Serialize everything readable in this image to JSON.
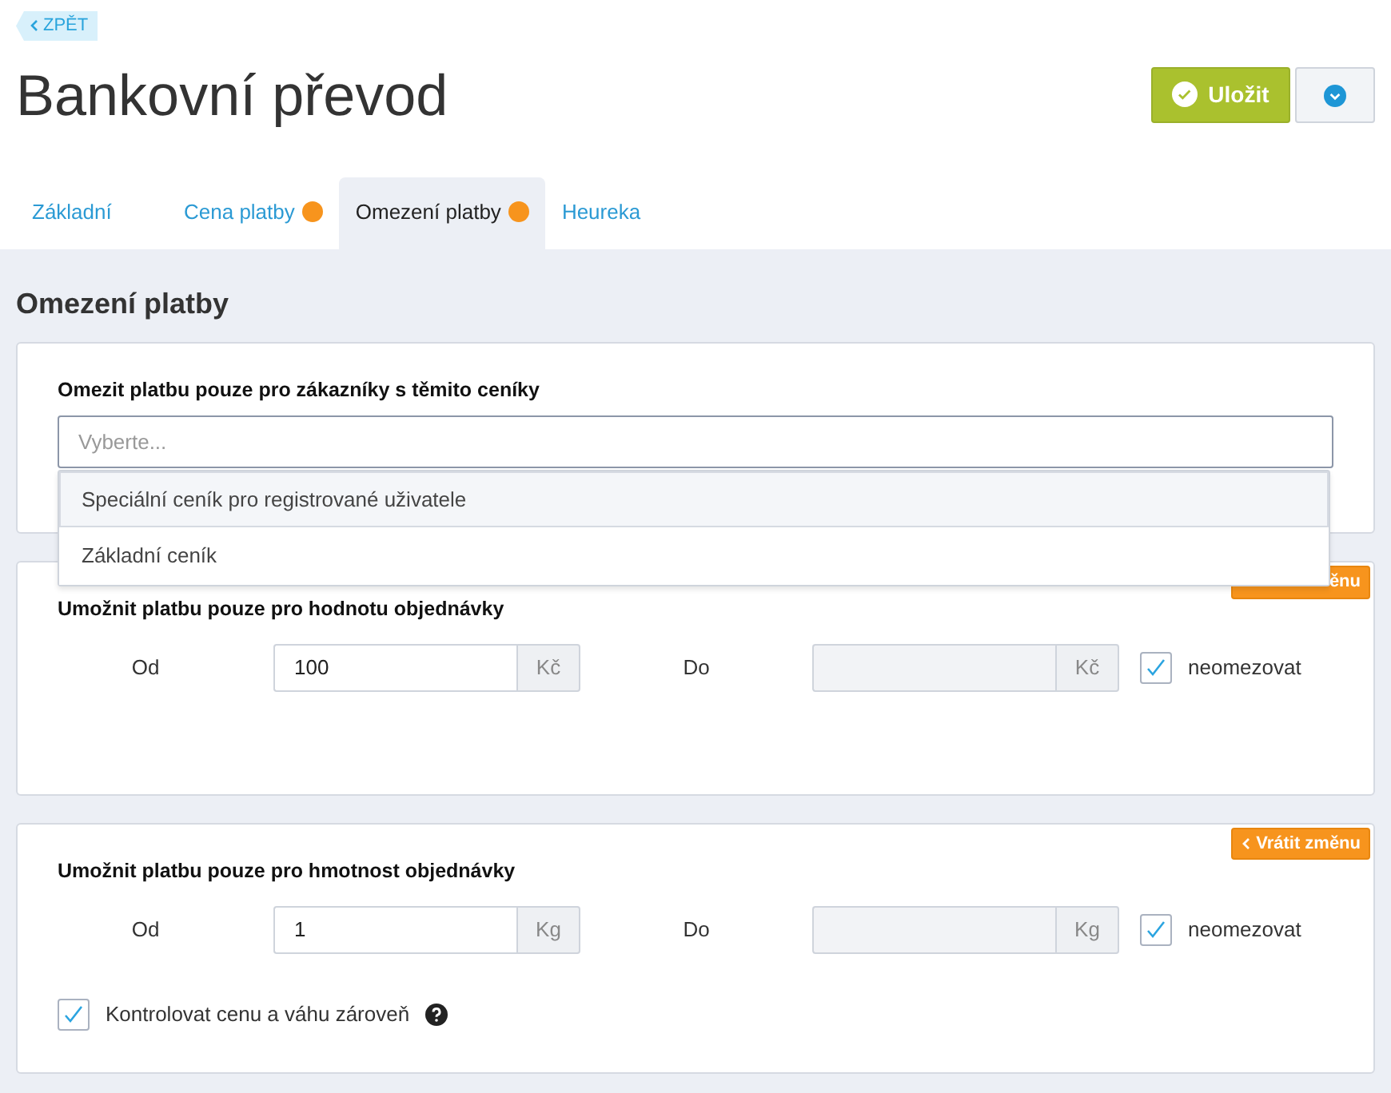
{
  "back_link": {
    "label": "ZPĚT"
  },
  "title": "Bankovní převod",
  "save_button": {
    "label": "Uložit"
  },
  "tabs": [
    {
      "label": "Základní",
      "selected": false,
      "indicator": false
    },
    {
      "label": "Cena platby",
      "selected": false,
      "indicator": true
    },
    {
      "label": "Omezení platby",
      "selected": true,
      "indicator": true
    },
    {
      "label": "Heureka",
      "selected": false,
      "indicator": false
    }
  ],
  "section_title": "Omezení platby",
  "pricelist_card": {
    "label": "Omezit platbu pouze pro zákazníky s těmito ceníky",
    "placeholder": "Vyberte...",
    "options": [
      {
        "label": "Speciální ceník pro registrované uživatele",
        "selected": true
      },
      {
        "label": "Základní ceník",
        "selected": false
      }
    ]
  },
  "range_cards": [
    {
      "revert_badge": "ěnu",
      "title": "Umožnit platbu pouze pro hodnotu objednávky",
      "from_label": "Od",
      "from_value": "100",
      "from_unit": "Kč",
      "to_unit": "Kč",
      "to_label": "Do",
      "unlimited": {
        "label": "neomezovat",
        "checked": true
      }
    },
    {
      "revert_badge": "Vrátit změnu",
      "title": "Umožnit platbu pouze pro hmotnost objednávky",
      "from_label": "Od",
      "from_value": "1",
      "from_unit": "Kg",
      "to_unit": "Kg",
      "to_label": "Do",
      "unlimited": {
        "label": "neomezovat",
        "checked": true
      },
      "extra_check": {
        "label": "Kontrolovat cenu a váhu zároveň",
        "checked": true
      }
    }
  ]
}
